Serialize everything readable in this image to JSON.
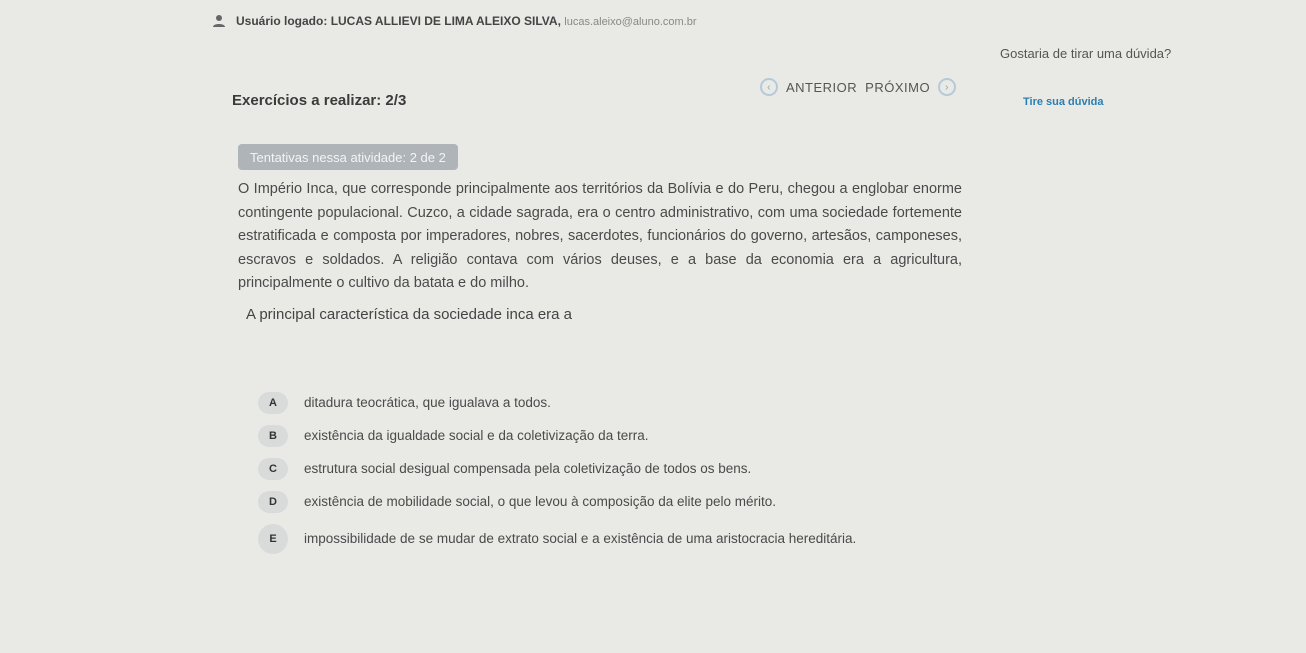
{
  "header": {
    "user_label": "Usuário logado:",
    "user_name": "LUCAS ALLIEVI DE LIMA ALEIXO SILVA,",
    "user_email": "lucas.aleixo@aluno.com.br",
    "user_icon": "user-icon"
  },
  "help": {
    "question": "Gostaria de tirar uma dúvida?",
    "link": "Tire sua dúvida"
  },
  "exercise": {
    "count_label": "Exercícios a realizar: 2/3",
    "attempts": "Tentativas nessa atividade: 2 de 2"
  },
  "nav": {
    "prev_icon": "chevron-left-icon",
    "prev_label": "ANTERIOR",
    "next_label": "PRÓXIMO",
    "next_icon": "chevron-right-icon"
  },
  "passage": "O Império Inca, que corresponde principalmente aos territórios da Bolívia e do Peru, chegou a englobar enorme contingente populacional. Cuzco, a cidade sagrada, era o centro administrativo, com uma sociedade fortemente estratificada e composta por imperadores, nobres, sacerdotes, funcionários do governo, artesãos, camponeses, escravos e soldados. A religião contava com vários deuses, e a base da economia era a agricultura, principalmente o cultivo da batata e do milho.",
  "question": "A principal característica da sociedade inca era a",
  "options": [
    {
      "letter": "A",
      "text": "ditadura teocrática, que igualava a todos."
    },
    {
      "letter": "B",
      "text": "existência da igualdade social e da coletivização da terra."
    },
    {
      "letter": "C",
      "text": "estrutura social desigual compensada pela coletivização de todos os bens."
    },
    {
      "letter": "D",
      "text": "existência de mobilidade social, o que levou à composição da elite pelo mérito."
    },
    {
      "letter": "E",
      "text": "impossibilidade de se mudar de extrato social e a existência de uma aristocracia hereditária."
    }
  ]
}
